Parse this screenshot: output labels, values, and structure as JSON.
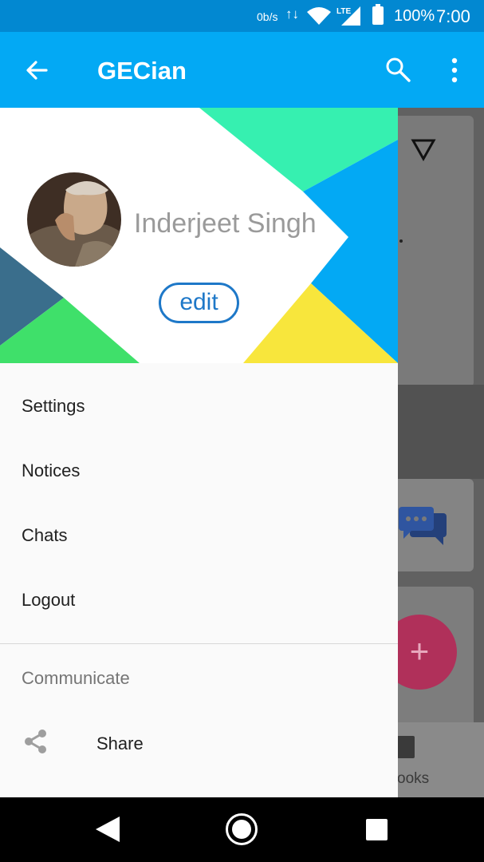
{
  "status_bar": {
    "net_speed": "0b/s",
    "data_arrows": "↑↓",
    "network": "LTE",
    "battery": "100%",
    "time": "7:00"
  },
  "app_bar": {
    "title": "GECian",
    "icons": [
      "arrow-back-icon",
      "search-icon",
      "more-vert-icon"
    ]
  },
  "drawer": {
    "user_name": "Inderjeet Singh",
    "edit_label": "edit",
    "menu_items": [
      {
        "label": "Settings"
      },
      {
        "label": "Notices"
      },
      {
        "label": "Chats"
      },
      {
        "label": "Logout"
      }
    ],
    "section_title": "Communicate",
    "share": {
      "label": "Share",
      "icon": "share-icon"
    }
  },
  "background": {
    "bottom_nav_label": "ooks",
    "fab_symbol": "+"
  },
  "colors": {
    "status_bar": "#0288d1",
    "app_bar": "#03a9f4",
    "edit_accent": "#1e78c8",
    "fab": "#b0305a"
  }
}
